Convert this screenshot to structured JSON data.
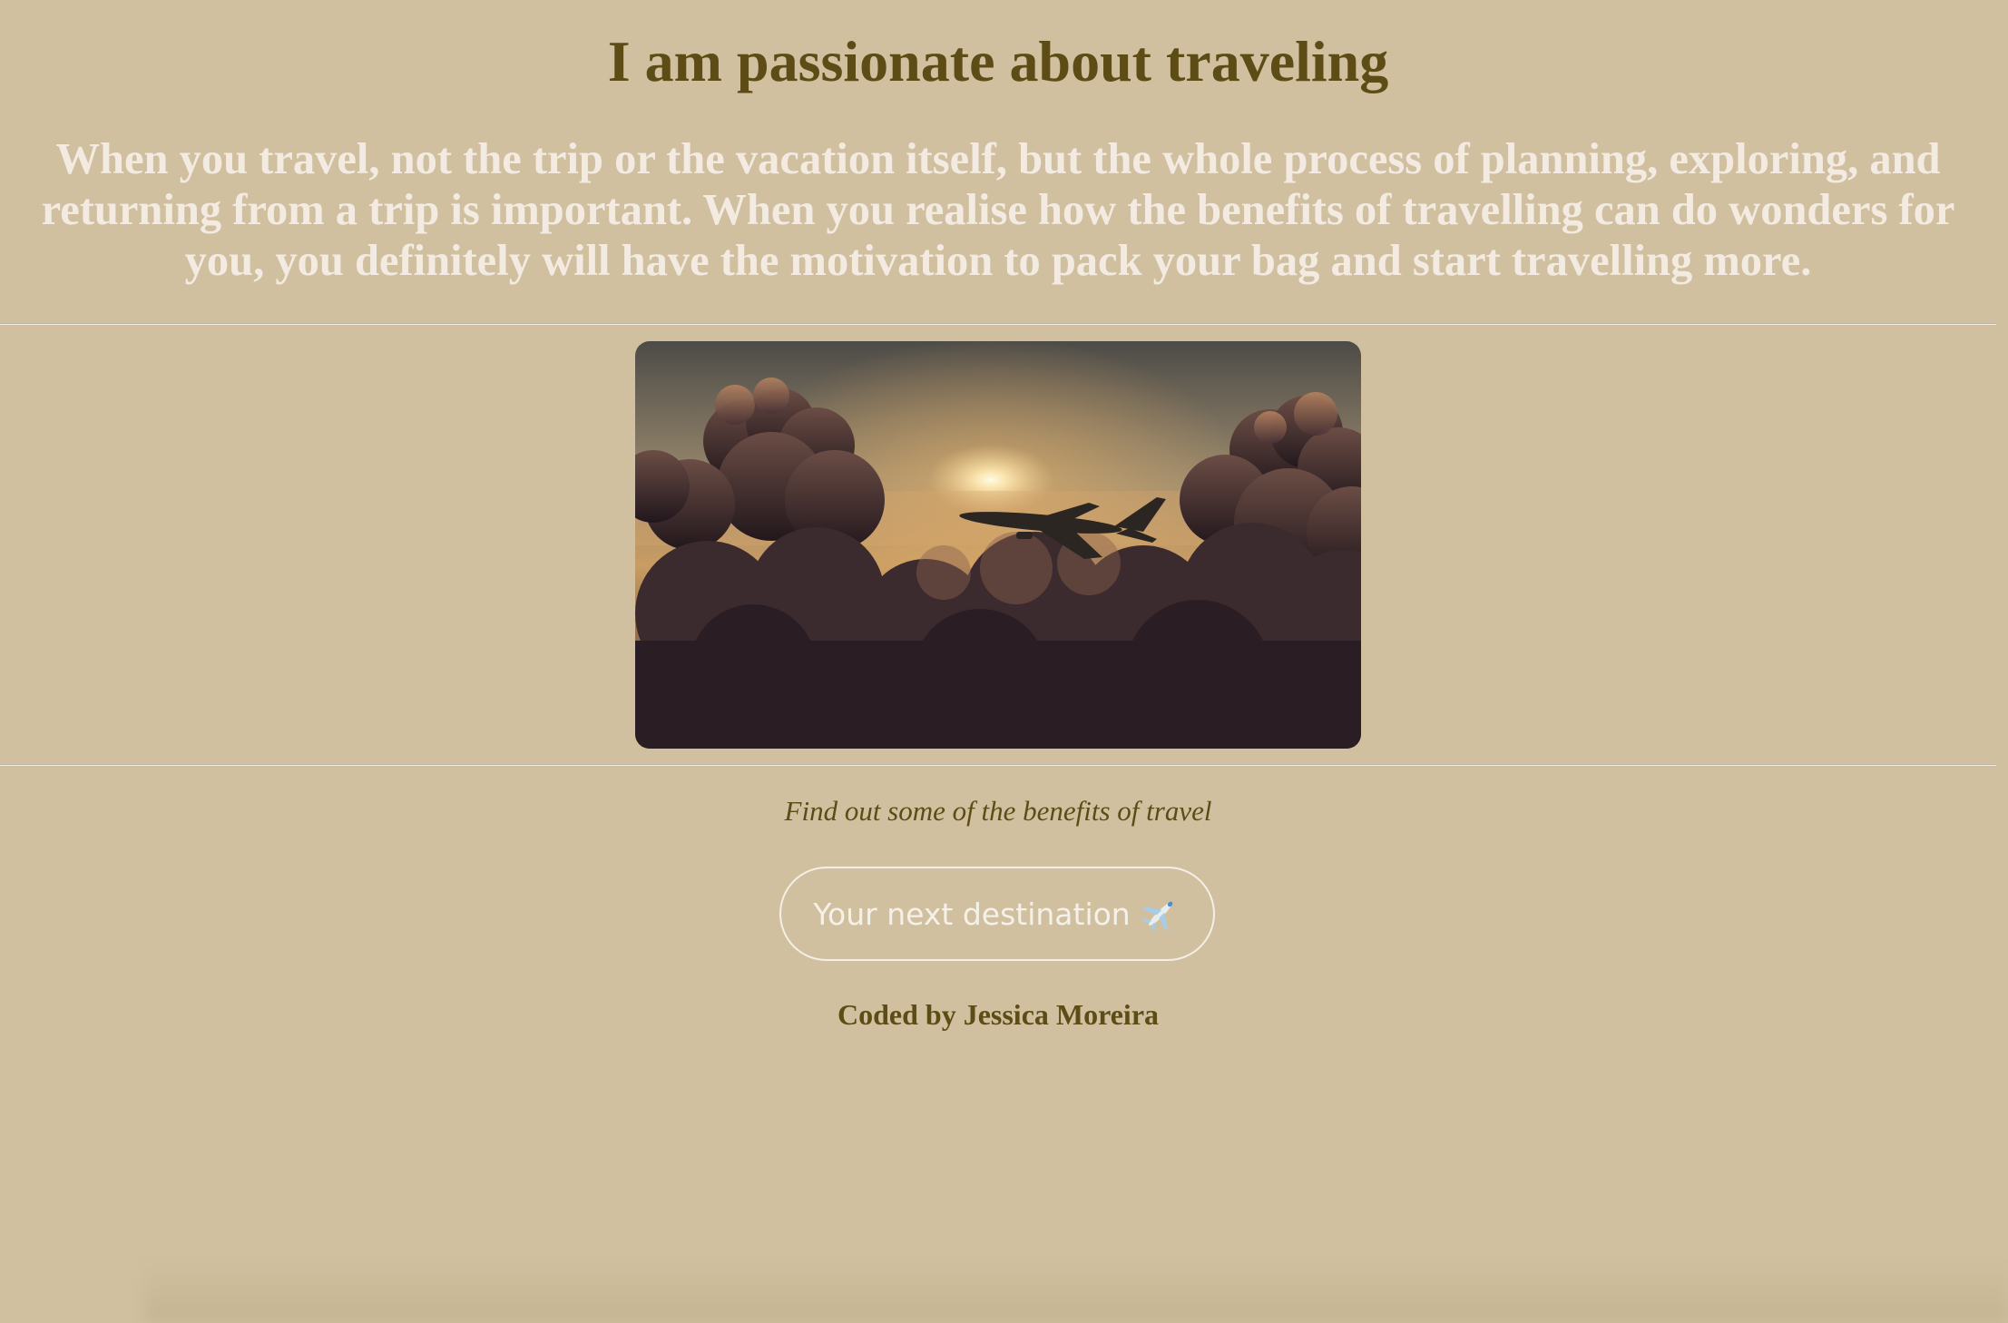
{
  "header": {
    "title": "I am passionate about traveling",
    "intro": "When you travel, not the trip or the vacation itself, but the whole process of planning, exploring, and returning from a trip is important. When you realise how the benefits of travelling can do wonders for you, you definitely will have the motivation to pack your bag and start travelling more."
  },
  "main": {
    "caption": "Find out some of the benefits of travel",
    "destination_button": {
      "label": "Your next destination",
      "icon": "airplane-icon"
    }
  },
  "footer": {
    "credit": "Coded by Jessica Moreira"
  },
  "colors": {
    "background": "#d0c09f",
    "heading": "#5e4c17",
    "intro_text": "#f3ebe1",
    "button_border": "#f4efe6"
  }
}
